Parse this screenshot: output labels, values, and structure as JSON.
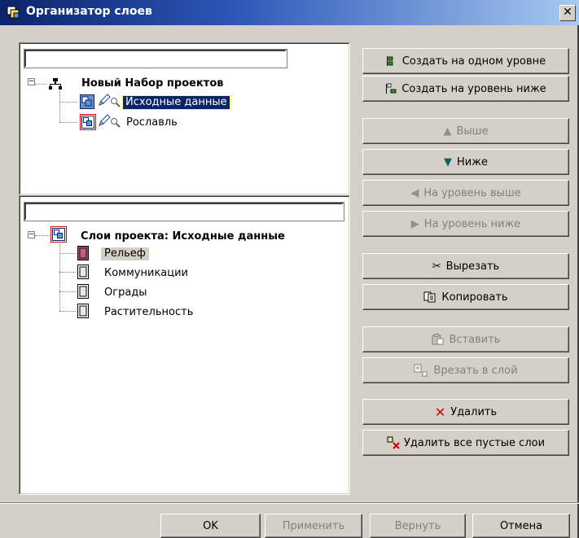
{
  "window": {
    "title": "Организатор слоев",
    "close_glyph": "✕"
  },
  "projects_tree": {
    "filter_value": "",
    "root": {
      "label": "Новый Набор проектов",
      "icon": "network-icon",
      "expander": "−"
    },
    "items": [
      {
        "label": "Исходные данные",
        "selected": true
      },
      {
        "label": "Рославль",
        "selected": false
      }
    ]
  },
  "layers_tree": {
    "filter_value": "",
    "root": {
      "label": "Слои проекта: Исходные данные",
      "expander": "−"
    },
    "items": [
      {
        "label": "Рельеф",
        "highlighted": true
      },
      {
        "label": "Коммуникации"
      },
      {
        "label": "Ограды"
      },
      {
        "label": "Растительность"
      }
    ]
  },
  "buttons": {
    "create_same_level": {
      "label": "Создать на одном уровне",
      "enabled": true
    },
    "create_level_below": {
      "label": "Создать на уровень ниже",
      "enabled": true
    },
    "up": {
      "label": "Выше",
      "enabled": false
    },
    "down": {
      "label": "Ниже",
      "enabled": true
    },
    "level_up": {
      "label": "На уровень выше",
      "enabled": false
    },
    "level_down": {
      "label": "На уровень ниже",
      "enabled": false
    },
    "cut": {
      "label": "Вырезать",
      "enabled": true
    },
    "copy": {
      "label": "Копировать",
      "enabled": true
    },
    "paste": {
      "label": "Вставить",
      "enabled": false
    },
    "cut_into_layer": {
      "label": "Врезать в слой",
      "enabled": false
    },
    "delete": {
      "label": "Удалить",
      "enabled": true
    },
    "delete_empty": {
      "label": "Удалить все пустые слои",
      "enabled": true
    }
  },
  "footer": {
    "ok": "OK",
    "apply": "Применить",
    "revert": "Вернуть",
    "cancel": "Отмена"
  },
  "colors": {
    "face": "#d4d0c8",
    "title_start": "#0a246a",
    "title_end": "#a6caf0",
    "selection": "#0a246a",
    "highlight_box": "#e00000",
    "down_arrow": "#0f5f5f",
    "delete_x": "#d00000"
  }
}
